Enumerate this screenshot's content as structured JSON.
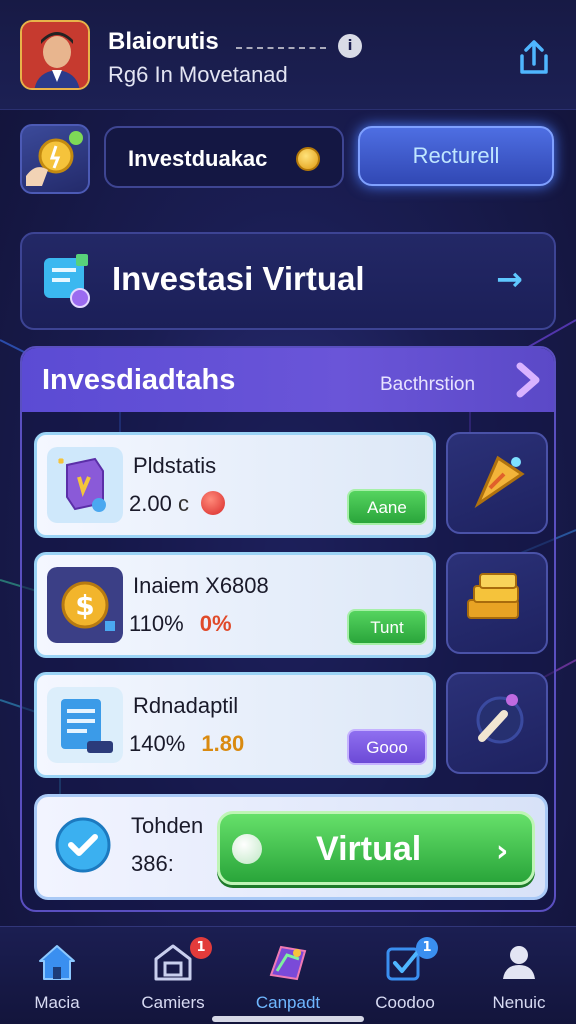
{
  "header": {
    "user_name": "Blaiorutis",
    "user_subtitle": "Rg6 In Movetanad",
    "info_icon": "i"
  },
  "toolbar": {
    "input_value": "Investduakac",
    "return_label": "Recturell"
  },
  "banner": {
    "title": "Investasi Virtual",
    "arrow": "→"
  },
  "panel": {
    "title": "Invesdiadtahs",
    "link_label": "Bacthrstion",
    "cards": [
      {
        "name": "Pldstatis",
        "value": "2.00",
        "suffix": "c",
        "button": "Aane"
      },
      {
        "name": "Inaiem X6808",
        "value": "110%",
        "accent": "0%",
        "button": "Tunt"
      },
      {
        "name": "Rdnadaptil",
        "value": "140%",
        "accent": "1.80",
        "button": "Gooo"
      }
    ],
    "bottom_card": {
      "name": "Tohden",
      "value": "386:",
      "button": "Virtual",
      "chevron": "›"
    }
  },
  "nav": {
    "items": [
      {
        "label": "Macia",
        "icon": "home-icon"
      },
      {
        "label": "Camiers",
        "icon": "shop-icon",
        "badge": "1"
      },
      {
        "label": "Canpadt",
        "icon": "portfolio-icon"
      },
      {
        "label": "Coodoo",
        "icon": "checkbox-icon",
        "badge": "1"
      },
      {
        "label": "Nenuic",
        "icon": "profile-icon"
      }
    ]
  },
  "colors": {
    "accent_green": "#2aa53b",
    "accent_purple": "#6c4ad6",
    "accent_blue": "#4a7bff",
    "background": "#1a1d52"
  }
}
